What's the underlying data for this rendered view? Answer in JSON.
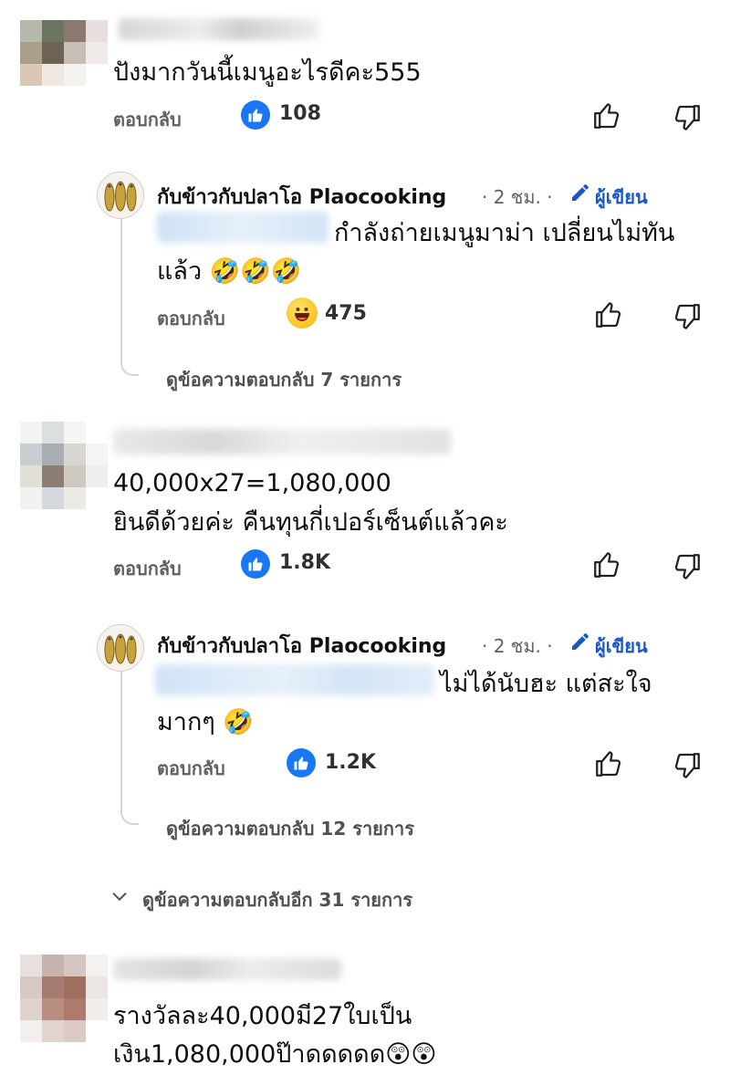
{
  "comments": [
    {
      "text": "ปังมากวันนี้เมนูอะไรดีคะ555",
      "reply_label": "ตอบกลับ",
      "reaction_count": "108",
      "reaction": "like",
      "replies": [
        {
          "page_name": "กับข้าวกับปลาโอ Plaocooking",
          "time": "· 2 ชม. ·",
          "author_badge": "ผู้เขียน",
          "text_line1": "กำลังถ่ายเมนูมาม่า เปลี่ยนไม่ทัน",
          "text_line2": "แล้ว 🤣🤣🤣",
          "reply_label": "ตอบกลับ",
          "reaction_count": "475",
          "reaction": "haha",
          "view_replies": "ดูข้อความตอบกลับ 7 รายการ"
        }
      ]
    },
    {
      "text_line1": "40,000x27=1,080,000",
      "text_line2": "ยินดีด้วยค่ะ คืนทุนกี่เปอร์เซ็นต์แล้วคะ",
      "reply_label": "ตอบกลับ",
      "reaction_count": "1.8K",
      "reaction": "like",
      "replies": [
        {
          "page_name": "กับข้าวกับปลาโอ Plaocooking",
          "time": "· 2 ชม. ·",
          "author_badge": "ผู้เขียน",
          "text_line1": "ไม่ได้นับฮะ แต่สะใจ",
          "text_line2": "มากๆ 🤣",
          "reply_label": "ตอบกลับ",
          "reaction_count": "1.2K",
          "reaction": "like",
          "view_replies": "ดูข้อความตอบกลับ 12 รายการ"
        }
      ],
      "more_replies": "ดูข้อความตอบกลับอีก 31 รายการ"
    },
    {
      "text_line1": "รางวัลละ40,000มี27ใบเป็น",
      "text_line2": "เงิน1,080,000ป๊าดดดดด😲😲"
    }
  ],
  "icons": {
    "like": "thumbs-up-icon",
    "dislike": "thumbs-down-icon",
    "author": "pencil-icon",
    "expand": "chevron-down-icon"
  },
  "colors": {
    "like_blue": "#1877f2",
    "author_blue": "#1a56c9",
    "muted": "#606060"
  }
}
